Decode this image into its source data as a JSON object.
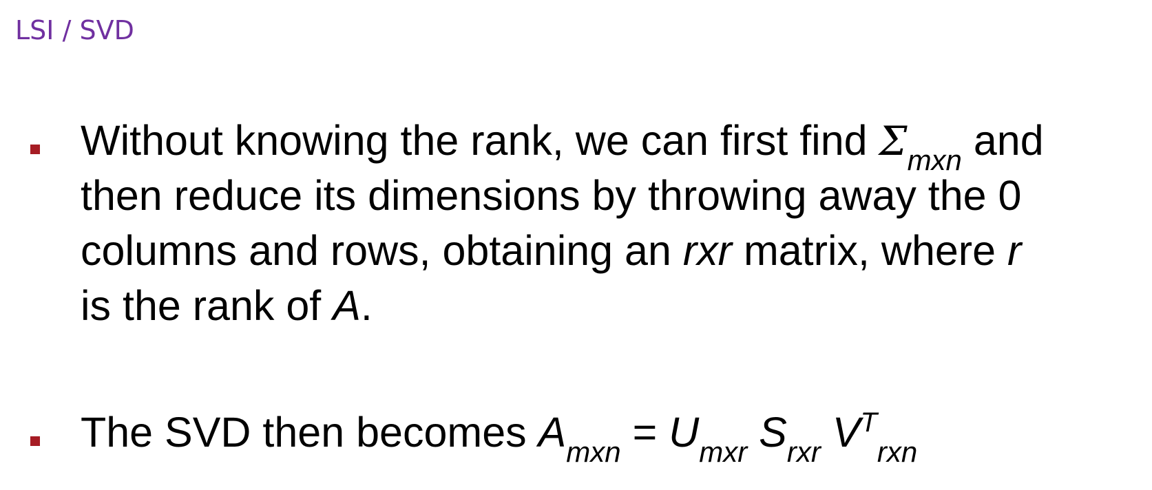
{
  "slide": {
    "title": "LSI / SVD"
  },
  "bullets": [
    {
      "lines": [
        {
          "text_a": "Without knowing the rank, we can first find ",
          "sigma": "Σ",
          "sigma_sub": "mxn",
          "text_b": " and"
        },
        {
          "text": "then reduce its dimensions by throwing away the 0"
        },
        {
          "text_a": "columns and rows, obtaining an ",
          "math_a": "rxr",
          "text_b": " matrix, where ",
          "math_b": "r"
        },
        {
          "text_a": "is the rank of ",
          "math_a": "A",
          "text_b": "."
        }
      ]
    },
    {
      "text": "The SVD then becomes ",
      "formula": {
        "a": "A",
        "a_sub": "mxn",
        "eq": " = ",
        "u": "U",
        "u_sub": "mxr",
        "s": "S",
        "s_sub": "rxr",
        "v": "V",
        "v_sup": "T",
        "v_sub": "rxn"
      }
    }
  ],
  "colors": {
    "title": "#7030a0",
    "bullet": "#a61c24",
    "text": "#000000"
  }
}
